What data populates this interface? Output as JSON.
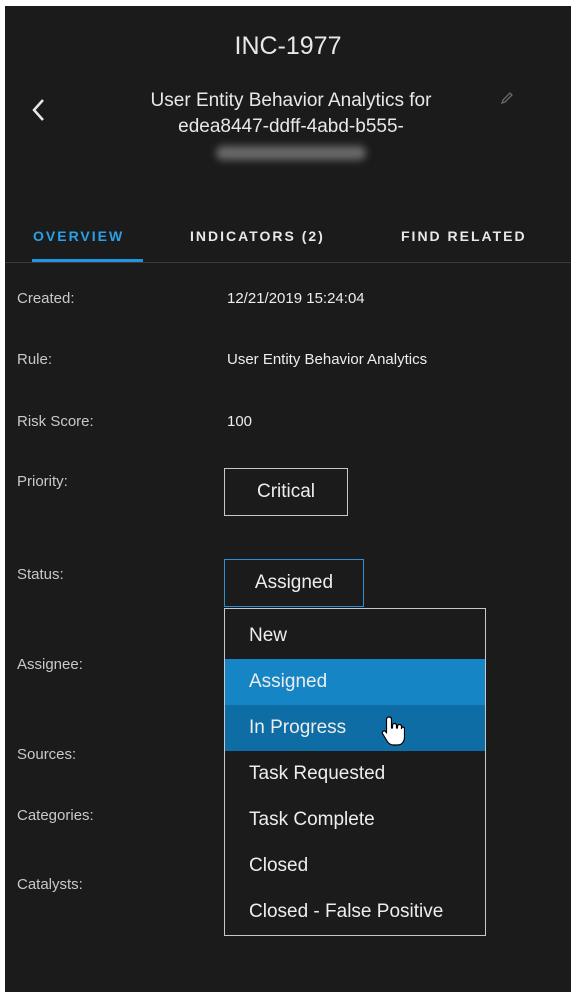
{
  "incident": {
    "id": "INC-1977",
    "title_line1": "User Entity Behavior Analytics for",
    "title_line2": "edea8447-ddff-4abd-b555-"
  },
  "tabs": [
    {
      "label": "OVERVIEW",
      "active": true
    },
    {
      "label": "INDICATORS (2)",
      "active": false
    },
    {
      "label": "FIND RELATED",
      "active": false
    }
  ],
  "overview": {
    "created_label": "Created:",
    "created_value": "12/21/2019 15:24:04",
    "rule_label": "Rule:",
    "rule_value": "User Entity Behavior Analytics",
    "risk_label": "Risk Score:",
    "risk_value": "100",
    "priority_label": "Priority:",
    "priority_value": "Critical",
    "status_label": "Status:",
    "status_value": "Assigned",
    "assignee_label": "Assignee:",
    "sources_label": "Sources:",
    "categories_label": "Categories:",
    "catalysts_label": "Catalysts:"
  },
  "status_dropdown": {
    "options": [
      "New",
      "Assigned",
      "In Progress",
      "Task Requested",
      "Task Complete",
      "Closed",
      "Closed - False Positive"
    ],
    "selected": "Assigned",
    "hovered": "In Progress"
  },
  "icons": {
    "back": "chevron-left-icon",
    "edit": "pencil-icon",
    "cursor": "hand-pointer-icon"
  },
  "colors": {
    "background": "#1b1b1b",
    "accent": "#1e96e0",
    "selected_option": "#1585c5",
    "hovered_option": "#0e6da4",
    "text": "#e6e6e6"
  }
}
